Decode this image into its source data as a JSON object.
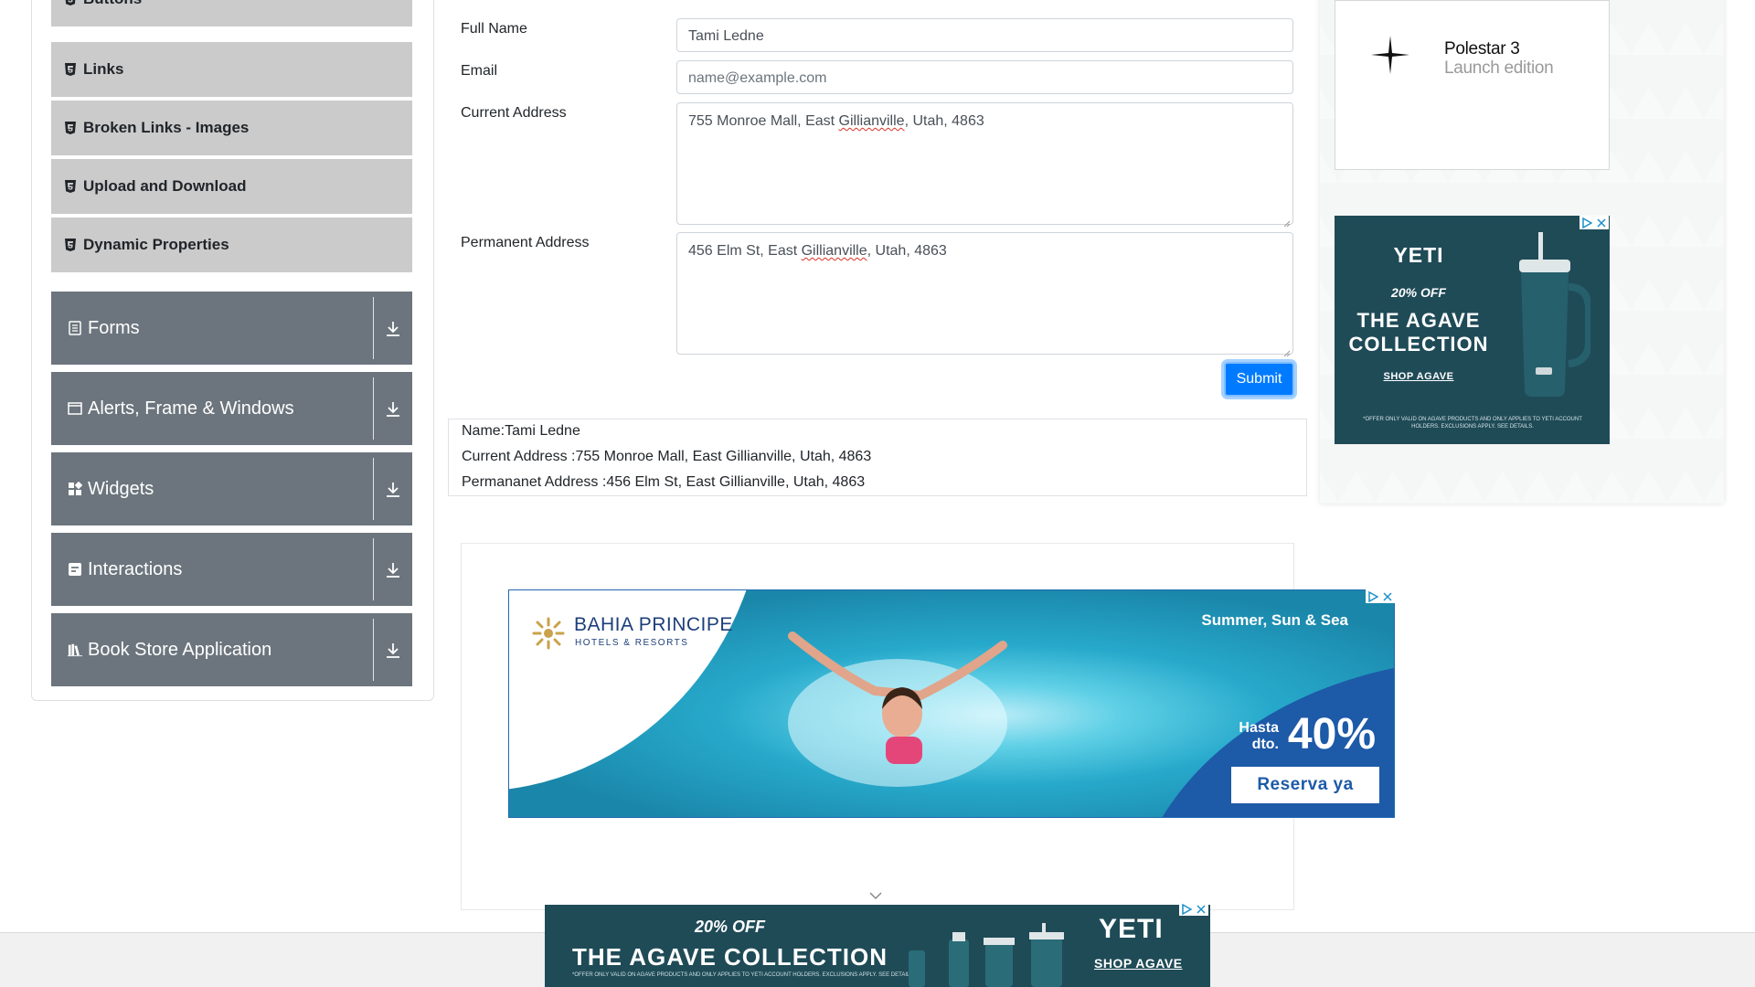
{
  "sidebar": {
    "sub_items": [
      {
        "label": "Buttons"
      },
      {
        "label": "Links"
      },
      {
        "label": "Broken Links - Images"
      },
      {
        "label": "Upload and Download"
      },
      {
        "label": "Dynamic Properties"
      }
    ],
    "groups": [
      {
        "label": "Forms",
        "icon": "form-icon"
      },
      {
        "label": "Alerts, Frame & Windows",
        "icon": "window-icon"
      },
      {
        "label": "Widgets",
        "icon": "widgets-icon"
      },
      {
        "label": "Interactions",
        "icon": "interactions-icon"
      },
      {
        "label": "Book Store Application",
        "icon": "books-icon"
      }
    ]
  },
  "form": {
    "full_name_label": "Full Name",
    "full_name_value": "Tami Ledne",
    "email_label": "Email",
    "email_placeholder": "name@example.com",
    "current_address_label": "Current Address",
    "current_address_parts": [
      "755 Monroe Mall, East ",
      "Gillianville",
      ", Utah, 4863"
    ],
    "permanent_address_label": "Permanent Address",
    "permanent_address_parts": [
      "456 Elm St, East ",
      "Gillianville",
      ", Utah, 4863"
    ],
    "submit_label": "Submit"
  },
  "output": {
    "name": "Name:Tami Ledne",
    "current_address": "Current Address :755 Monroe Mall, East Gillianville, Utah, 4863",
    "permanent_address": "Permananet Address :456 Elm St, East Gillianville, Utah, 4863"
  },
  "ads": {
    "polestar": {
      "name": "Polestar 3",
      "sub": "Launch edition"
    },
    "yeti_side": {
      "brand": "YETI",
      "offer": "20% OFF",
      "line1": "THE AGAVE",
      "line2": "COLLECTION",
      "shop": "SHOP AGAVE",
      "fine": "*OFFER ONLY VALID ON AGAVE PRODUCTS AND ONLY APPLIES TO YETI ACCOUNT HOLDERS. EXCLUSIONS APPLY. SEE DETAILS."
    },
    "bahia": {
      "brand": "BAHIA PRINCIPE",
      "brand_sub": "HOTELS & RESORTS",
      "tagline": "Summer, Sun & Sea",
      "hasta": "Hasta",
      "dto": "dto.",
      "percent": "40%",
      "cta": "Reserva ya"
    },
    "yeti_bottom": {
      "offer": "20% OFF",
      "collection": "THE AGAVE COLLECTION",
      "fine": "*OFFER ONLY VALID ON AGAVE PRODUCTS AND ONLY APPLIES TO YETI ACCOUNT HOLDERS. EXCLUSIONS APPLY. SEE DETAILS.",
      "brand": "YETI",
      "shop": "SHOP AGAVE"
    }
  },
  "colors": {
    "accent": "#007bff",
    "group_bg": "#6c757d",
    "sub_item_bg": "#cbcbcb"
  }
}
